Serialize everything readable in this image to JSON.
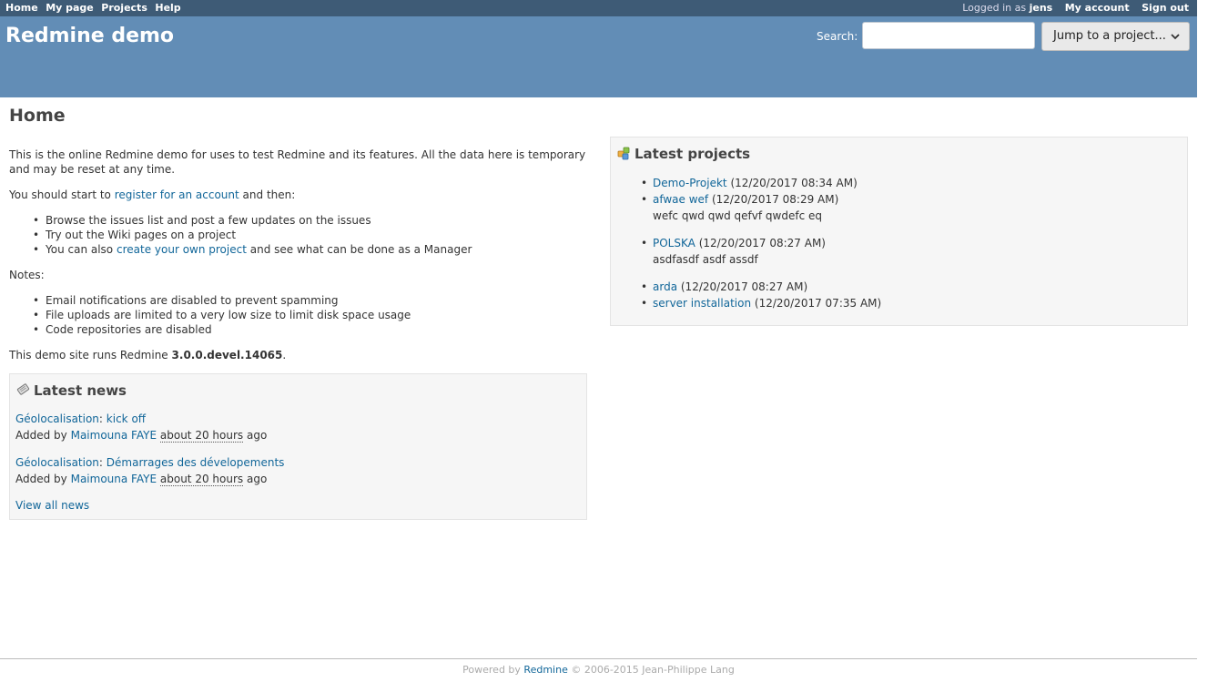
{
  "top_menu": {
    "home": "Home",
    "my_page": "My page",
    "projects": "Projects",
    "help": "Help",
    "logged_in_prefix": "Logged in as",
    "user": "jens",
    "my_account": "My account",
    "sign_out": "Sign out"
  },
  "header": {
    "title": "Redmine demo",
    "search_label": "Search:",
    "search_value": "",
    "jump_label": "Jump to a project..."
  },
  "page": {
    "title": "Home",
    "intro": "This is the online Redmine demo for uses to test Redmine and its features. All the data here is temporary and may be reset at any time.",
    "start_prefix": "You should start to",
    "start_link": "register for an account",
    "start_suffix": "and then:",
    "start_items": [
      "Browse the issues list and post a few updates on the issues",
      "Try out the Wiki pages on a project"
    ],
    "start_item3_prefix": "You can also",
    "start_item3_link": "create your own project",
    "start_item3_suffix": "and see what can be done as a Manager",
    "notes_label": "Notes:",
    "notes": [
      "Email notifications are disabled to prevent spamming",
      "File uploads are limited to a very low size to limit disk space usage",
      "Code repositories are disabled"
    ],
    "version_prefix": "This demo site runs Redmine",
    "version": "3.0.0.devel.14065",
    "version_suffix": "."
  },
  "news": {
    "heading": "Latest news",
    "items": [
      {
        "project": "Géolocalisation",
        "sep": ":",
        "title": "kick off",
        "added_by": "Added by",
        "author": "Maimouna FAYE",
        "time": "about 20 hours",
        "ago": "ago"
      },
      {
        "project": "Géolocalisation",
        "sep": ":",
        "title": "Démarrages des dévelopements",
        "added_by": "Added by",
        "author": "Maimouna FAYE",
        "time": "about 20 hours",
        "ago": "ago"
      }
    ],
    "view_all": "View all news"
  },
  "projects": {
    "heading": "Latest projects",
    "items": [
      {
        "name": "Demo-Projekt",
        "date": "(12/20/2017 08:34 AM)",
        "desc": ""
      },
      {
        "name": "afwae wef",
        "date": "(12/20/2017 08:29 AM)",
        "desc": "wefc qwd qwd qefvf qwdefc eq"
      },
      {
        "name": "POLSKA",
        "date": "(12/20/2017 08:27 AM)",
        "desc": "asdfasdf asdf assdf"
      },
      {
        "name": "arda",
        "date": "(12/20/2017 08:27 AM)",
        "desc": ""
      },
      {
        "name": "server installation",
        "date": "(12/20/2017 07:35 AM)",
        "desc": ""
      }
    ]
  },
  "footer": {
    "powered_by": "Powered by",
    "redmine": "Redmine",
    "copyright": "© 2006-2015 Jean-Philippe Lang"
  },
  "colors": {
    "top_menu_bg": "#3e5b76",
    "header_bg": "#628db6",
    "link": "#116699",
    "box_bg": "#f6f6f6"
  }
}
